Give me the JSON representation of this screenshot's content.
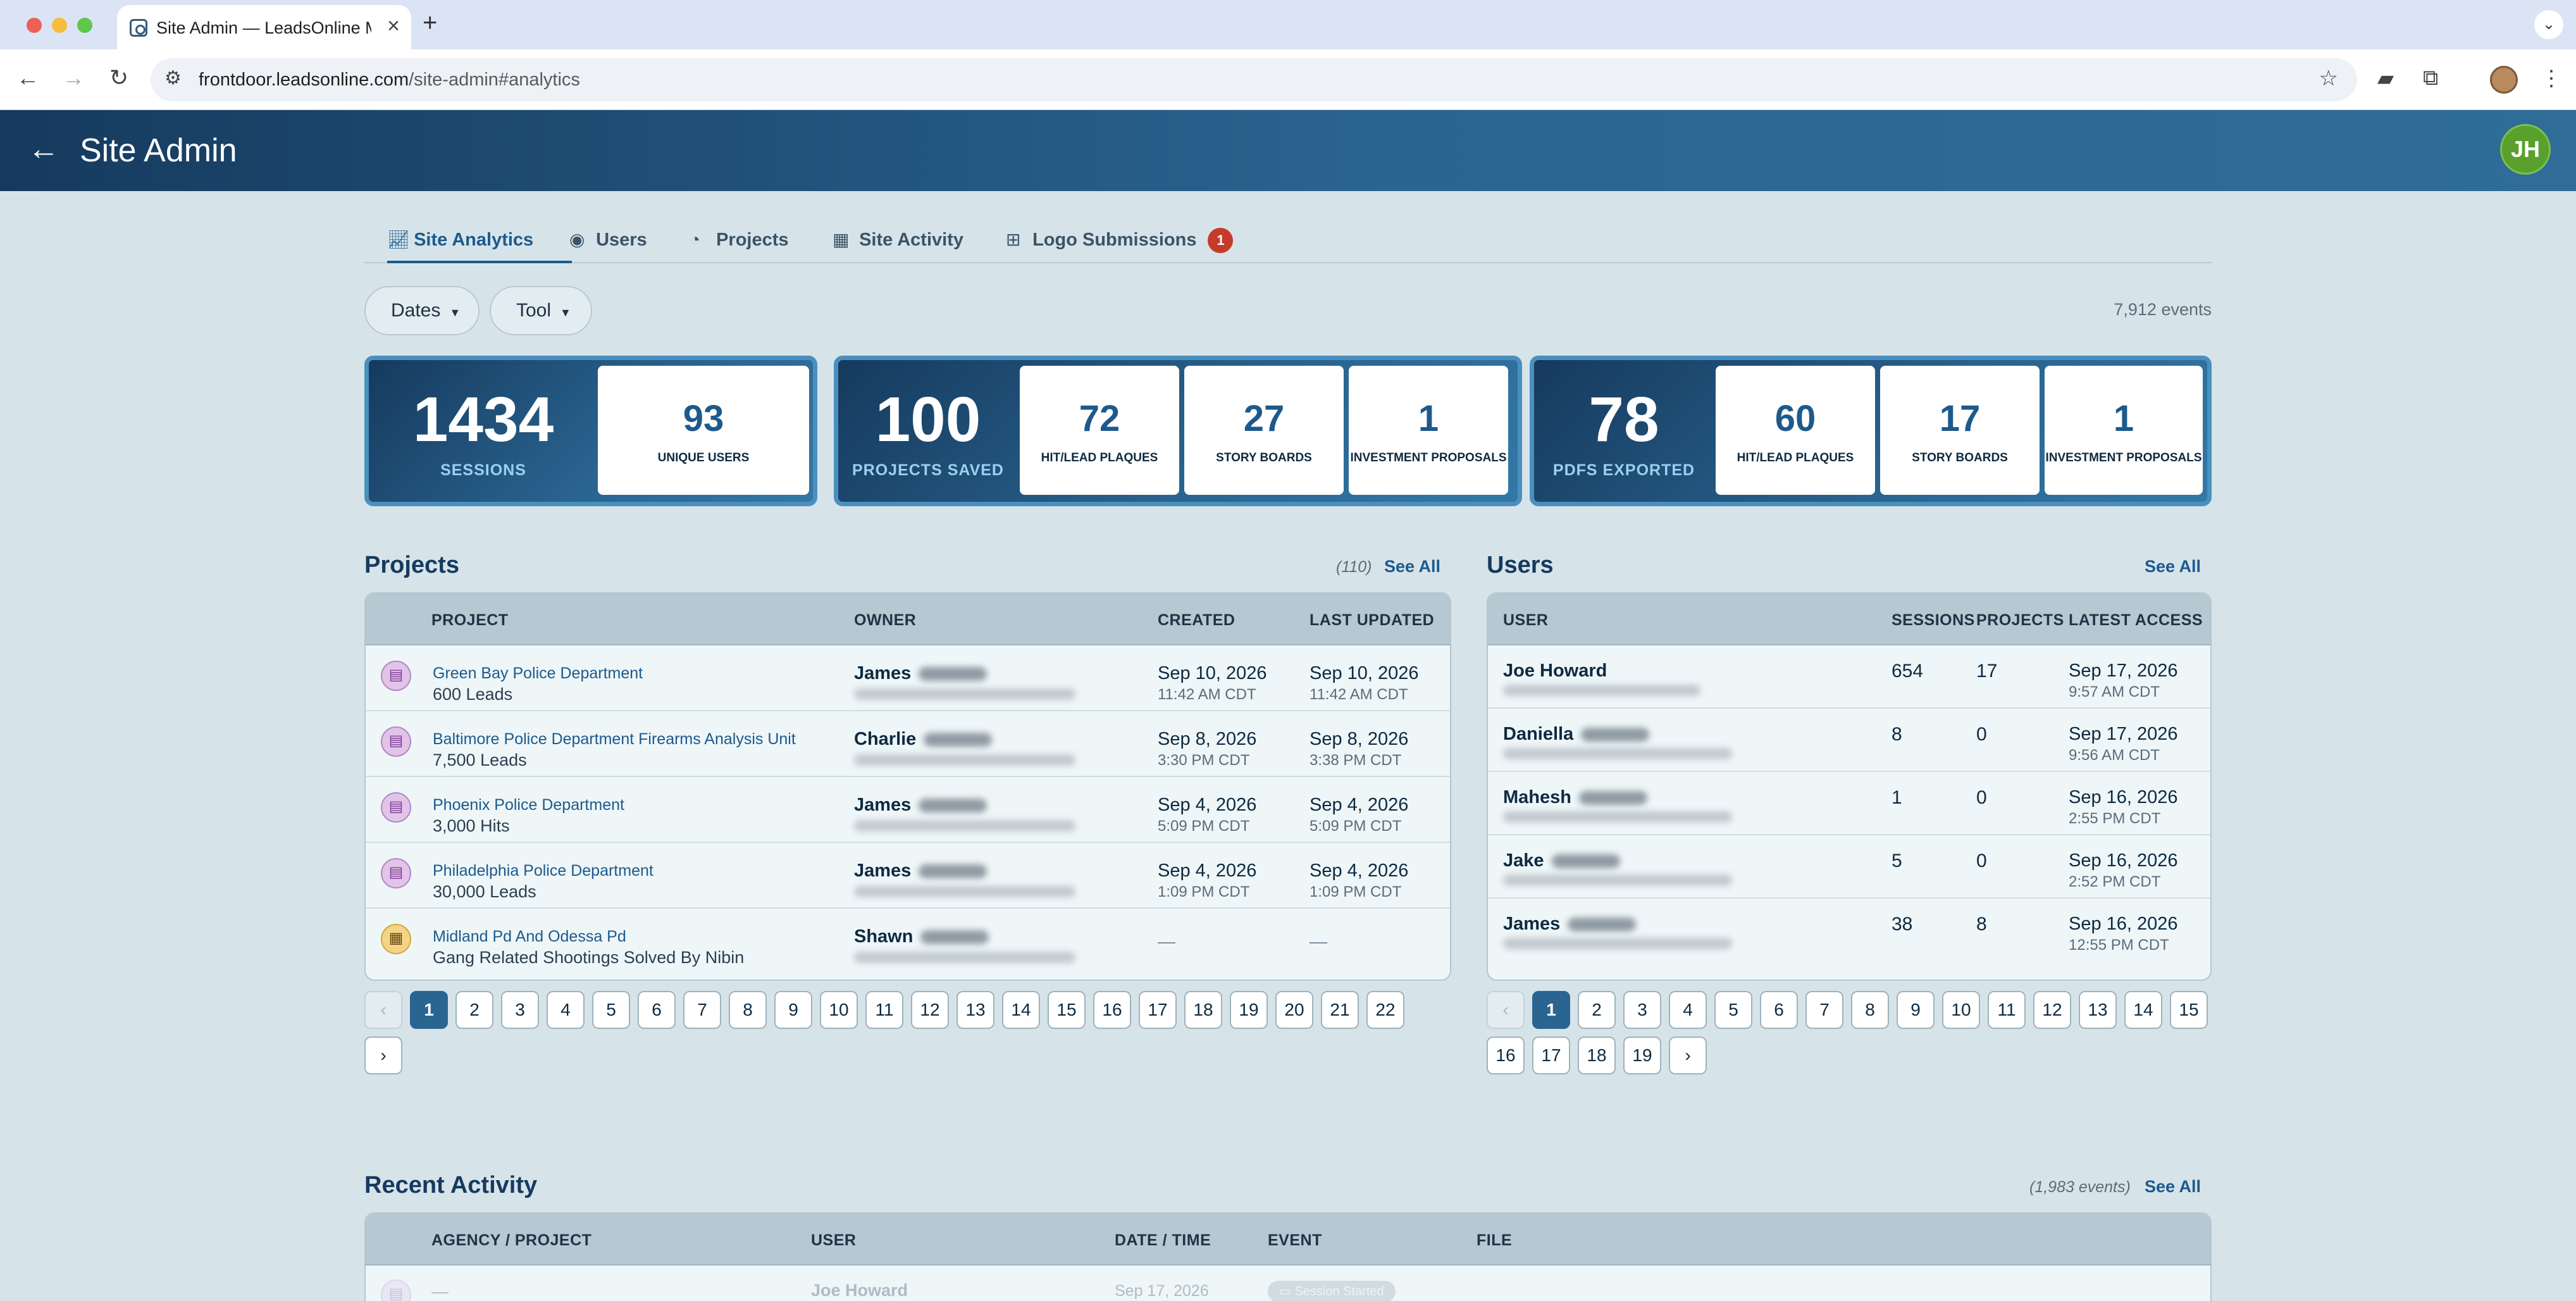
{
  "browser": {
    "tab_title": "Site Admin — LeadsOnline Ma",
    "url_host": "frontdoor.leadsonline.com",
    "url_path": "/site-admin#analytics"
  },
  "header": {
    "title": "Site Admin",
    "avatar_initials": "JH"
  },
  "tabs": [
    {
      "label": "Site Analytics",
      "icon": "chart-icon"
    },
    {
      "label": "Users",
      "icon": "user-circle-icon"
    },
    {
      "label": "Projects",
      "icon": "palette-icon"
    },
    {
      "label": "Site Activity",
      "icon": "calendar-icon"
    },
    {
      "label": "Logo Submissions",
      "icon": "grid-icon",
      "badge": "1"
    }
  ],
  "filters": {
    "dates_label": "Dates",
    "tool_label": "Tool",
    "events_count": "7,912 events"
  },
  "stats": {
    "sessions": {
      "value": "1434",
      "label": "SESSIONS"
    },
    "unique_users": {
      "value": "93",
      "label": "UNIQUE USERS"
    },
    "projects_saved": {
      "value": "100",
      "label": "PROJECTS SAVED"
    },
    "saved_breakdown": [
      {
        "value": "72",
        "label": "HIT/LEAD PLAQUES"
      },
      {
        "value": "27",
        "label": "STORY BOARDS"
      },
      {
        "value": "1",
        "label": "INVESTMENT PROPOSALS"
      }
    ],
    "pdfs_exported": {
      "value": "78",
      "label": "PDFS EXPORTED"
    },
    "pdf_breakdown": [
      {
        "value": "60",
        "label": "HIT/LEAD PLAQUES"
      },
      {
        "value": "17",
        "label": "STORY BOARDS"
      },
      {
        "value": "1",
        "label": "INVESTMENT PROPOSALS"
      }
    ]
  },
  "projects": {
    "title": "Projects",
    "count": "(110)",
    "see_all": "See All",
    "columns": [
      "PROJECT",
      "OWNER",
      "CREATED",
      "LAST UPDATED"
    ],
    "rows": [
      {
        "name": "Green Bay Police Department",
        "sub": "600 Leads",
        "owner": "James",
        "created_date": "Sep 10, 2026",
        "created_time": "11:42 AM CDT",
        "updated_date": "Sep 10, 2026",
        "updated_time": "11:42 AM CDT",
        "icon": "plaque-icon"
      },
      {
        "name": "Baltimore Police Department Firearms Analysis Unit",
        "sub": "7,500 Leads",
        "owner": "Charlie",
        "created_date": "Sep 8, 2026",
        "created_time": "3:30 PM CDT",
        "updated_date": "Sep 8, 2026",
        "updated_time": "3:38 PM CDT",
        "icon": "plaque-icon"
      },
      {
        "name": "Phoenix Police Department",
        "sub": "3,000 Hits",
        "owner": "James",
        "created_date": "Sep 4, 2026",
        "created_time": "5:09 PM CDT",
        "updated_date": "Sep 4, 2026",
        "updated_time": "5:09 PM CDT",
        "icon": "plaque-icon"
      },
      {
        "name": "Philadelphia Police Department",
        "sub": "30,000 Leads",
        "owner": "James",
        "created_date": "Sep 4, 2026",
        "created_time": "1:09 PM CDT",
        "updated_date": "Sep 4, 2026",
        "updated_time": "1:09 PM CDT",
        "icon": "plaque-icon"
      },
      {
        "name": "Midland Pd And Odessa Pd",
        "sub": "Gang Related Shootings Solved By Nibin",
        "owner": "Shawn",
        "created_date": "—",
        "created_time": "",
        "updated_date": "—",
        "updated_time": "",
        "icon": "storyboard-icon"
      }
    ],
    "pages": [
      "1",
      "2",
      "3",
      "4",
      "5",
      "6",
      "7",
      "8",
      "9",
      "10",
      "11",
      "12",
      "13",
      "14",
      "15",
      "16",
      "17",
      "18",
      "19",
      "20",
      "21",
      "22"
    ],
    "prev": "‹",
    "next": "›"
  },
  "users": {
    "title": "Users",
    "see_all": "See All",
    "columns": [
      "USER",
      "SESSIONS",
      "PROJECTS",
      "LATEST ACCESS"
    ],
    "rows": [
      {
        "name": "Joe Howard",
        "sessions": "654",
        "projects": "17",
        "date": "Sep 17, 2026",
        "time": "9:57 AM CDT"
      },
      {
        "name": "Daniella",
        "sessions": "8",
        "projects": "0",
        "date": "Sep 17, 2026",
        "time": "9:56 AM CDT"
      },
      {
        "name": "Mahesh",
        "sessions": "1",
        "projects": "0",
        "date": "Sep 16, 2026",
        "time": "2:55 PM CDT"
      },
      {
        "name": "Jake",
        "sessions": "5",
        "projects": "0",
        "date": "Sep 16, 2026",
        "time": "2:52 PM CDT"
      },
      {
        "name": "James",
        "sessions": "38",
        "projects": "8",
        "date": "Sep 16, 2026",
        "time": "12:55 PM CDT"
      }
    ],
    "pages": [
      "1",
      "2",
      "3",
      "4",
      "5",
      "6",
      "7",
      "8",
      "9",
      "10",
      "11",
      "12",
      "13",
      "14",
      "15",
      "16",
      "17",
      "18",
      "19"
    ],
    "prev": "‹",
    "next": "›"
  },
  "activity": {
    "title": "Recent Activity",
    "count": "(1,983 events)",
    "see_all": "See All",
    "columns": [
      "AGENCY / PROJECT",
      "USER",
      "DATE / TIME",
      "EVENT",
      "FILE"
    ],
    "first_row": {
      "project": "—",
      "user": "Joe Howard",
      "date": "Sep 17, 2026",
      "event": "Session Started"
    }
  },
  "colors": {
    "header_dark": "#163a5e",
    "header_light": "#2f6d98",
    "accent": "#1d5a8c",
    "badge": "#c63a2b",
    "avatar": "#5aa02c"
  }
}
